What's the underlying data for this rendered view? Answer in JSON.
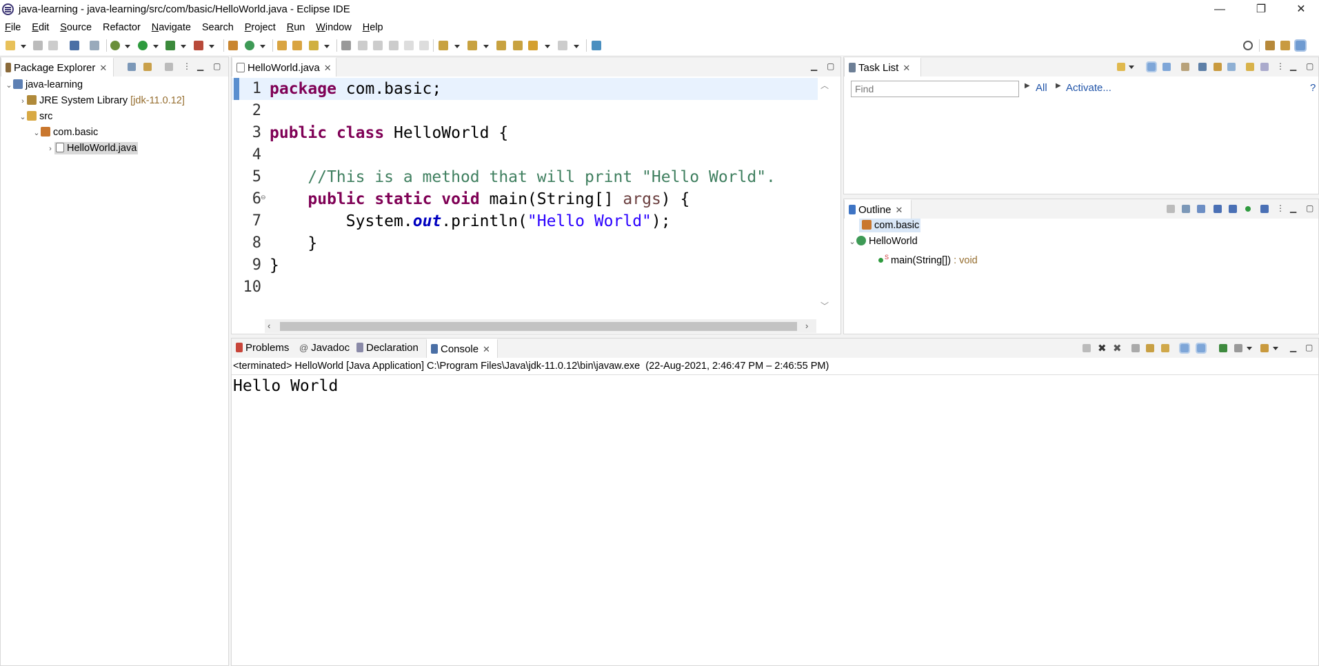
{
  "window": {
    "title": "java-learning - java-learning/src/com/basic/HelloWorld.java - Eclipse IDE",
    "minimize": "—",
    "maximize": "❐",
    "close": "✕"
  },
  "menu": [
    {
      "label": "File",
      "mnemonic": "F",
      "rest": "ile"
    },
    {
      "label": "Edit",
      "mnemonic": "E",
      "rest": "dit"
    },
    {
      "label": "Source",
      "mnemonic": "S",
      "rest": "ource"
    },
    {
      "label": "Refactor",
      "mnemonic": "",
      "rest": "Refactor"
    },
    {
      "label": "Navigate",
      "mnemonic": "N",
      "rest": "avigate"
    },
    {
      "label": "Search",
      "mnemonic": "",
      "rest": "Search"
    },
    {
      "label": "Project",
      "mnemonic": "P",
      "rest": "roject"
    },
    {
      "label": "Run",
      "mnemonic": "R",
      "rest": "un"
    },
    {
      "label": "Window",
      "mnemonic": "W",
      "rest": "indow"
    },
    {
      "label": "Help",
      "mnemonic": "H",
      "rest": "elp"
    }
  ],
  "package_explorer": {
    "tab_label": "Package Explorer",
    "tree": {
      "project": "java-learning",
      "jre_label": "JRE System Library",
      "jre_version": "[jdk-11.0.12]",
      "src": "src",
      "package": "com.basic",
      "file": "HelloWorld.java"
    }
  },
  "editor": {
    "tab_label": "HelloWorld.java",
    "line_numbers": [
      "1",
      "2",
      "3",
      "4",
      "5",
      "6",
      "7",
      "8",
      "9",
      "10"
    ],
    "code": {
      "l1_kw": "package",
      "l1_rest": " com.basic;",
      "l3_kw1": "public",
      "l3_kw2": "class",
      "l3_rest": " HelloWorld {",
      "l5_comment": "    //This is a method that will print \"Hello World\".",
      "l6_indent": "    ",
      "l6_kw1": "public",
      "l6_kw2": "static",
      "l6_kw3": "void",
      "l6_mid": " main(String[] ",
      "l6_var": "args",
      "l6_end": ") {",
      "l7_pre": "        System.",
      "l7_field": "out",
      "l7_mid": ".println(",
      "l7_str": "\"Hello World\"",
      "l7_end": ");",
      "l8": "    }",
      "l9": "}"
    }
  },
  "task_list": {
    "tab_label": "Task List",
    "find_placeholder": "Find",
    "all_link": "All",
    "activate_link": "Activate...",
    "help": "?"
  },
  "outline": {
    "tab_label": "Outline",
    "package": "com.basic",
    "class": "HelloWorld",
    "method": "main(String[])",
    "method_type": " : void",
    "static_marker": "S"
  },
  "bottom_tabs": [
    {
      "label": "Problems"
    },
    {
      "label": "Javadoc"
    },
    {
      "label": "Declaration"
    },
    {
      "label": "Console"
    }
  ],
  "console": {
    "header": "<terminated> HelloWorld [Java Application] C:\\Program Files\\Java\\jdk-11.0.12\\bin\\javaw.exe  (22-Aug-2021, 2:46:47 PM – 2:46:55 PM)",
    "output": "Hello World"
  },
  "colors": {
    "keyword": "#7f0055",
    "comment": "#3f7f5f",
    "string": "#2a00ff",
    "field": "#0000c0",
    "selection": "#d9e7f7"
  }
}
